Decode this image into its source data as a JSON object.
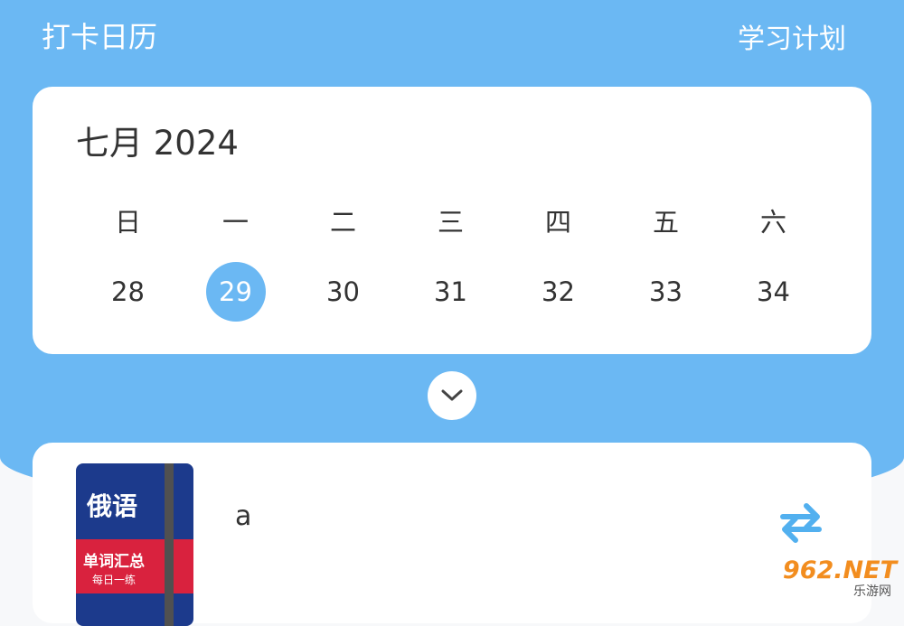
{
  "header": {
    "title": "打卡日历",
    "plan_link": "学习计划"
  },
  "calendar": {
    "month_title": "七月 2024",
    "weekdays": [
      "日",
      "一",
      "二",
      "三",
      "四",
      "五",
      "六"
    ],
    "dates": [
      "28",
      "29",
      "30",
      "31",
      "32",
      "33",
      "34"
    ],
    "selected_date": "29"
  },
  "book": {
    "cover_lang": "俄语",
    "cover_subtitle": "单词汇总",
    "cover_tagline": "每日一练",
    "name": "a"
  },
  "watermark": {
    "main": "962.NET",
    "sub": "乐游网"
  },
  "colors": {
    "accent": "#6bb8f3",
    "card": "#ffffff",
    "text": "#333333"
  },
  "icons": {
    "expand": "chevron-down-icon",
    "swap": "swap-arrows-icon"
  }
}
